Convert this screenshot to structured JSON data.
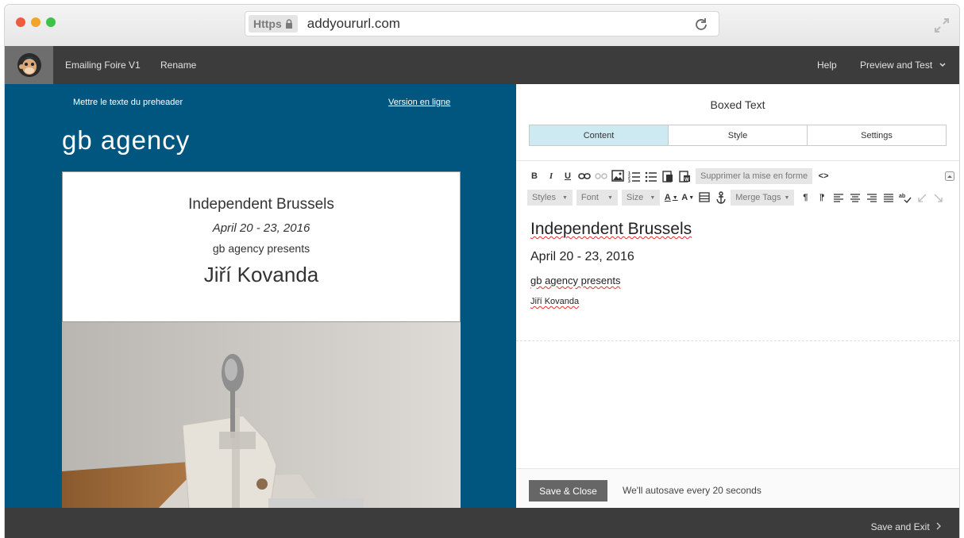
{
  "browser": {
    "protocol": "https",
    "url": "addyoururl.com",
    "controls": [
      "close",
      "minimize",
      "maximize"
    ]
  },
  "appbar": {
    "campaign_name": "Emailing Foire V1",
    "rename": "Rename",
    "help": "Help",
    "preview": "Preview and Test"
  },
  "email": {
    "preheader": "Mettre le texte du preheader",
    "version_link": "Version en ligne",
    "brand": "gb agency",
    "box": {
      "title": "Independent Brussels",
      "dates": "April 20 - 23, 2016",
      "presents": "gb agency presents",
      "artist": "Jiří Kovanda"
    }
  },
  "panel": {
    "title": "Boxed Text",
    "tabs": [
      {
        "label": "Content",
        "active": true
      },
      {
        "label": "Style",
        "active": false
      },
      {
        "label": "Settings",
        "active": false
      }
    ],
    "toolbar": {
      "remove_format": "Supprimer la mise en forme",
      "styles": "Styles",
      "font": "Font",
      "size": "Size",
      "merge_tags": "Merge Tags"
    },
    "editor": {
      "heading": "Independent Brussels",
      "dates": "April 20 - 23, 2016",
      "presents": "gb agency presents",
      "artist": "Jiří Kovanda"
    },
    "save_close": "Save & Close",
    "autosave": "We'll autosave every 20 seconds"
  },
  "footer": {
    "save_exit": "Save and Exit"
  },
  "colors": {
    "email_background": "#00567e",
    "appbar": "#3c3c3c",
    "active_tab": "#cdeaf3",
    "save_button": "#666666"
  }
}
